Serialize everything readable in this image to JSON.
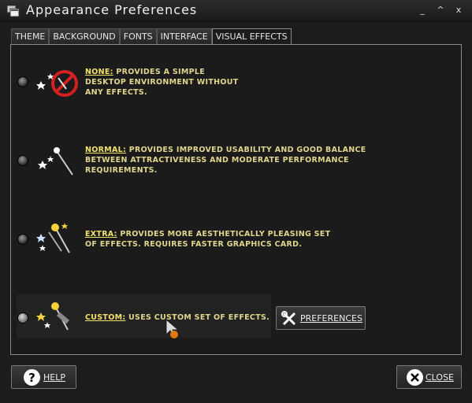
{
  "window": {
    "title": "Appearance Preferences",
    "controls": [
      "_",
      "^",
      "x"
    ]
  },
  "tabs": [
    {
      "label": "THEME"
    },
    {
      "label": "BACKGROUND"
    },
    {
      "label": "FONTS"
    },
    {
      "label": "INTERFACE"
    },
    {
      "label": "VISUAL EFFECTS",
      "active": true
    }
  ],
  "options": [
    {
      "heading": "NONE:",
      "text": "PROVIDES A SIMPLE",
      "text2": "DESKTOP ENVIRONMENT WITHOUT",
      "text3": "ANY EFFECTS.",
      "selected": false
    },
    {
      "heading": "NORMAL:",
      "text": "PROVIDES IMPROVED USABILITY AND GOOD BALANCE",
      "text2": "BETWEEN ATTRACTIVENESS AND MODERATE PERFORMANCE",
      "text3": "REQUIREMENTS.",
      "selected": false
    },
    {
      "heading": "EXTRA:",
      "text": "PROVIDES MORE AESTHETICALLY PLEASING SET",
      "text2": "OF EFFECTS. REQUIRES FASTER GRAPHICS CARD.",
      "text3": "",
      "selected": false
    },
    {
      "heading": "CUSTOM:",
      "text": "USES CUSTOM SET OF EFFECTS.",
      "text2": "",
      "text3": "",
      "selected": true
    }
  ],
  "custom": {
    "preferences_label": "PREFERENCES"
  },
  "footer": {
    "help_label": "HELP",
    "close_label": "CLOSE"
  },
  "colors": {
    "text": "#e0d58c",
    "heading": "#f2e26a",
    "background": "#1b1b1b",
    "border": "#8a8a8a"
  }
}
